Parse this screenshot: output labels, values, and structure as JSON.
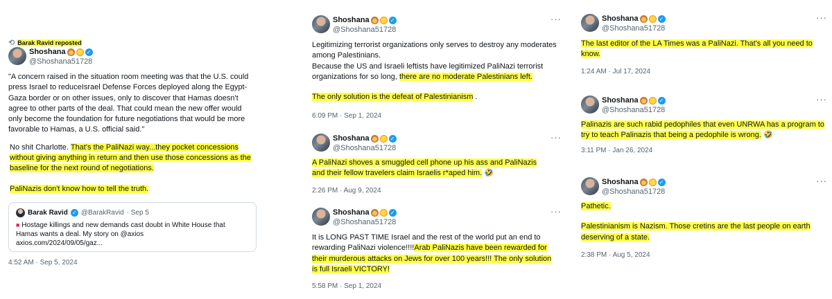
{
  "colors": {
    "highlight": "#ffff47",
    "verified": "#1d9bf0",
    "muted": "#536471"
  },
  "author": {
    "name": "Shoshana",
    "handle": "@Shoshana51728",
    "badge_icons": [
      "lion-emoji-icon",
      "sun-emoji-icon",
      "verified-badge-icon"
    ]
  },
  "more_icon": "···",
  "tweet1": {
    "repost_label": "Barak Ravid reposted",
    "quote_text": "\"A concern raised in the situation room meeting was that the U.S. could press Israel to reduceIsrael Defense Forces deployed along the Egypt-Gaza border or on other issues, only to discover that Hamas doesn't agree to other parts of the deal. That could mean the new offer would only become the foundation for future negotiations that would be more favorable to Hamas, a U.S. official said.\"",
    "p1_plain": "No shit Charlotte.  ",
    "p1_hl": " That's the PaliNazi way...they pocket concessions without giving anything in return and then use those concessions as the baseline for the next round of negotiations.",
    "p2_hl": "PaliNazis don't know how to tell the truth.",
    "quoted": {
      "name": "Barak Ravid",
      "handle": "@BarakRavid",
      "date": "· Sep 5",
      "text": "Hostage killings and new demands cast doubt in White House that Hamas wants a deal. My story on @axios",
      "link": "axios.com/2024/09/05/gaz..."
    },
    "timestamp": "4:52 AM · Sep 5, 2024"
  },
  "tweet2": {
    "p1_plain": "Legitimizing terrorist organizations only serves to destroy any moderates among Palestinians.",
    "p2_plain": "Because the US and Israeli leftists have legitimized PaliNazi terrorist organizations  for so long, ",
    "p2_hl": "there are no moderate Palestinians left.",
    "p3_hl": "The only solution is the defeat of Palestinianism",
    "p3_plain": " .",
    "timestamp": "6:09 PM · Sep 1, 2024"
  },
  "tweet3": {
    "text_hl": "A PaliNazi shoves a smuggled cell phone up his ass and PaliNazis and their fellow travelers claim Israelis r*aped him.",
    "emoji": "🤣",
    "timestamp": "2:26 PM · Aug 9, 2024"
  },
  "tweet4": {
    "p_plain": "It is LONG PAST TIME Israel and the rest of the world put an end to rewarding PaliNazi violence!!!!",
    "p_hl": "Arab PaliNazis have been rewarded for their murderous  attacks on Jews for over 100 years!!! The only solution is full Israeli VICTORY!",
    "timestamp": "5:58 PM · Sep 1, 2024"
  },
  "tweet5": {
    "text_hl": "The last editor of the LA Times was a PaliNazi. That's all you need to know.",
    "timestamp": "1:24 AM · Jul 17, 2024"
  },
  "tweet6": {
    "text_hl": "Palinazis are such rabid pedophiles that even UNRWA has a program to try to teach Palinazis that being a pedophile is wrong.",
    "emoji": "🤣",
    "timestamp": "3:11 PM · Jan 26, 2024"
  },
  "tweet7": {
    "p1_hl": "Pathetic.",
    "p2_hl": "Palestinianism  is Nazism. Those cretins are the last people on earth deserving of a state.",
    "timestamp": "2:38 PM · Aug 5, 2024"
  }
}
